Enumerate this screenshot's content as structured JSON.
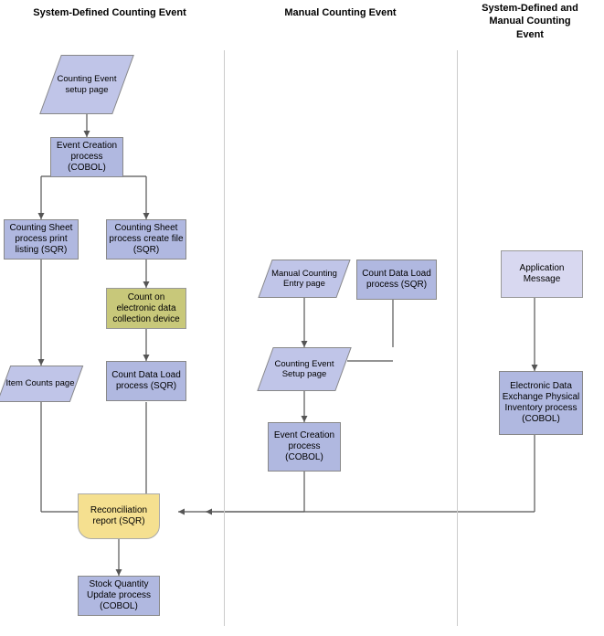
{
  "headers": {
    "col1": "System-Defined Counting Event",
    "col2": "Manual Counting Event",
    "col3_line1": "System-Defined and",
    "col3_line2": "Manual Counting",
    "col3_line3": "Event"
  },
  "shapes": {
    "counting_event_setup": "Counting Event setup page",
    "event_creation_1": "Event Creation process (COBOL)",
    "counting_sheet_print": "Counting Sheet process print listing (SQR)",
    "counting_sheet_file": "Counting Sheet process create file (SQR)",
    "count_on_device": "Count on electronic data collection device",
    "item_counts": "Item Counts page",
    "count_data_load_1": "Count Data Load process (SQR)",
    "reconciliation": "Reconciliation report (SQR)",
    "stock_quantity": "Stock Quantity Update process (COBOL)",
    "manual_counting_entry": "Manual Counting Entry page",
    "count_data_load_2": "Count Data Load process (SQR)",
    "counting_event_setup2": "Counting Event Setup page",
    "event_creation_2": "Event Creation process (COBOL)",
    "application_message": "Application Message",
    "edi_process": "Electronic Data Exchange Physical Inventory process (COBOL)"
  }
}
